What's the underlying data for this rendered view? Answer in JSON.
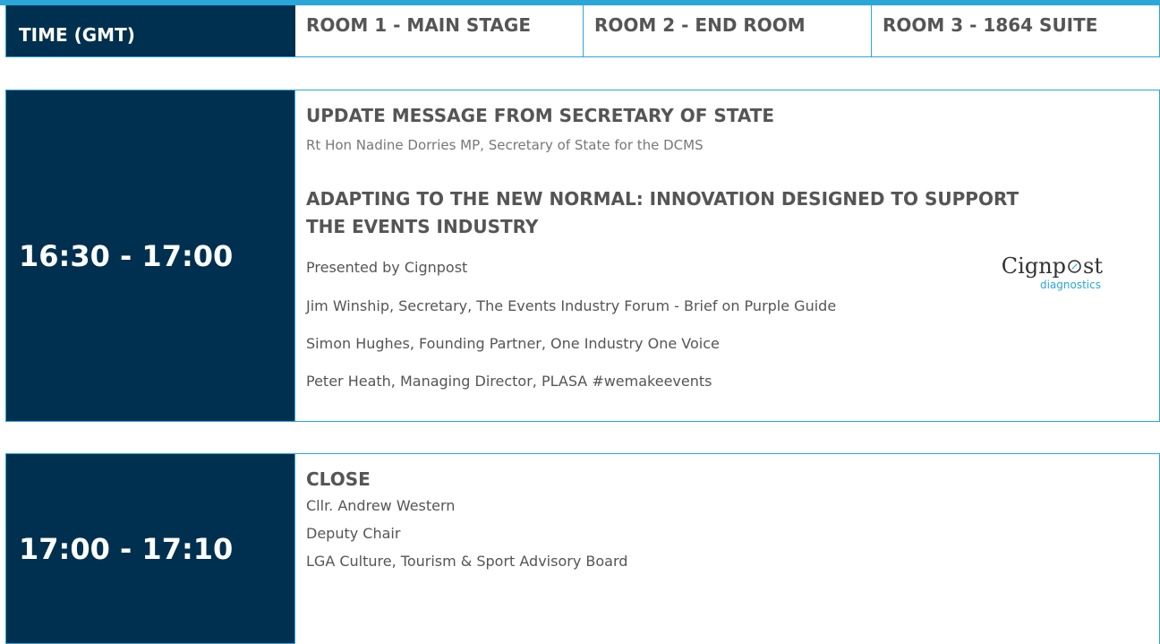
{
  "header": {
    "time_label": "TIME (GMT)",
    "rooms": [
      "ROOM 1 - MAIN STAGE",
      "ROOM 2 - END ROOM",
      "ROOM 3 - 1864 SUITE"
    ]
  },
  "sessions": [
    {
      "time": "16:30 - 17:00",
      "items": [
        {
          "title": "UPDATE MESSAGE FROM SECRETARY OF STATE",
          "subtitle": "Rt Hon Nadine Dorries MP, Secretary of State for the DCMS"
        },
        {
          "title_line1": "ADAPTING TO THE NEW NORMAL: INNOVATION DESIGNED TO SUPPORT",
          "title_line2": "THE EVENTS INDUSTRY",
          "presented_by": "Presented by Cignpost",
          "speakers": [
            "Jim Winship, Secretary, The Events Industry Forum - Brief on Purple Guide",
            "Simon Hughes, Founding Partner, One Industry One Voice",
            "Peter Heath, Managing Director, PLASA #wemakeevents"
          ]
        }
      ],
      "logo": {
        "main_before": "Cignp",
        "main_after": "st",
        "sub": "diagnostics"
      }
    },
    {
      "time": "17:00 - 17:10",
      "title": "CLOSE",
      "lines": [
        "Cllr. Andrew Western",
        "Deputy Chair",
        "LGA Culture, Tourism & Sport Advisory Board"
      ]
    }
  ],
  "colors": {
    "navy": "#00304f",
    "accent": "#2aa6d9",
    "text": "#555555",
    "logo_sub": "#2aa6d9"
  }
}
